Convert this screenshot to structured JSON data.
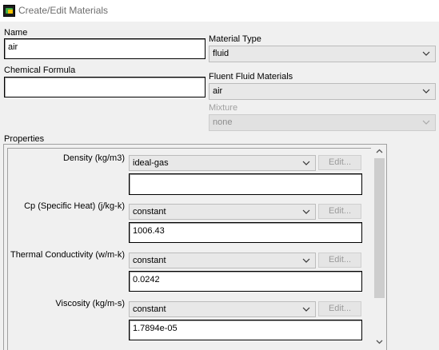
{
  "window": {
    "title": "Create/Edit Materials"
  },
  "name_field": {
    "label": "Name",
    "value": "air"
  },
  "formula_field": {
    "label": "Chemical Formula",
    "value": ""
  },
  "material_type": {
    "label": "Material Type",
    "value": "fluid"
  },
  "fluent_fluid_materials": {
    "label": "Fluent Fluid Materials",
    "value": "air"
  },
  "mixture": {
    "label": "Mixture",
    "value": "none"
  },
  "properties": {
    "label": "Properties",
    "edit_label": "Edit...",
    "density": {
      "label": "Density (kg/m3)",
      "method": "ideal-gas",
      "value": ""
    },
    "cp": {
      "label": "Cp (Specific Heat) (j/kg-k)",
      "method": "constant",
      "value": "1006.43"
    },
    "conductivity": {
      "label": "Thermal Conductivity (w/m-k)",
      "method": "constant",
      "value": "0.0242"
    },
    "viscosity": {
      "label": "Viscosity (kg/m-s)",
      "method": "constant",
      "value": "1.7894e-05"
    }
  },
  "icons": {
    "app": "fluent-app-icon",
    "dropdown": "chevron-down-icon",
    "scroll_up": "scroll-up-arrow-icon",
    "scroll_down": "scroll-down-arrow-icon"
  }
}
